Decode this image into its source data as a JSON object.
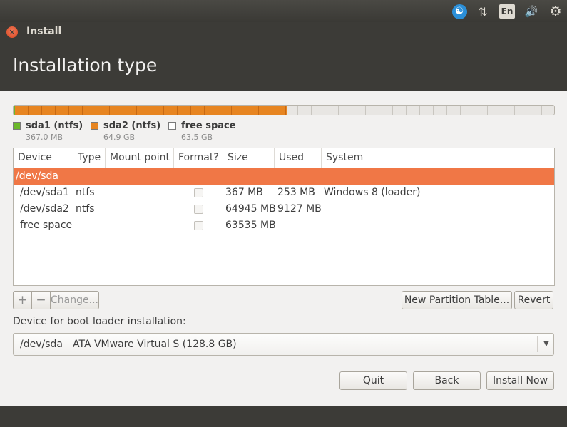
{
  "panel": {
    "keyboard_label": "En",
    "accessibility_icon": "accessibility-icon",
    "network_icon": "network-arrows-icon",
    "sound_icon": "speaker-icon",
    "settings_icon": "gear-icon"
  },
  "window": {
    "title": "Install"
  },
  "page": {
    "title": "Installation type"
  },
  "partition_bar": {
    "segments": [
      {
        "name": "sda1 (ntfs)",
        "size": "367.0 MB",
        "color": "#6bb82a",
        "fraction": 0.0028
      },
      {
        "name": "sda2 (ntfs)",
        "size": "64.9 GB",
        "color": "#e78521",
        "fraction": 0.5042
      },
      {
        "name": "free space",
        "size": "63.5 GB",
        "color": "#e8e6e3",
        "fraction": 0.493
      }
    ]
  },
  "legend": {
    "sda1": {
      "label": "sda1 (ntfs)",
      "size": "367.0 MB",
      "color": "#6bb82a"
    },
    "sda2": {
      "label": "sda2 (ntfs)",
      "size": "64.9 GB",
      "color": "#e78521"
    },
    "free": {
      "label": "free space",
      "size": "63.5 GB",
      "color": "#ffffff"
    }
  },
  "table": {
    "headers": {
      "device": "Device",
      "type": "Type",
      "mount": "Mount point",
      "format": "Format?",
      "size": "Size",
      "used": "Used",
      "system": "System"
    },
    "disk_row": {
      "device": "/dev/sda"
    },
    "rows": [
      {
        "device": "/dev/sda1",
        "type": "ntfs",
        "mount": "",
        "format": false,
        "size": "367 MB",
        "used": "253 MB",
        "system": "Windows 8 (loader)"
      },
      {
        "device": "/dev/sda2",
        "type": "ntfs",
        "mount": "",
        "format": false,
        "size": "64945 MB",
        "used": "9127 MB",
        "system": ""
      },
      {
        "device": "free space",
        "type": "",
        "mount": "",
        "format": false,
        "size": "63535 MB",
        "used": "",
        "system": ""
      }
    ]
  },
  "toolbar": {
    "add_label": "+",
    "remove_label": "−",
    "change_label": "Change...",
    "new_table_label": "New Partition Table...",
    "revert_label": "Revert"
  },
  "bootloader": {
    "label": "Device for boot loader installation:",
    "device": "/dev/sda",
    "description": "ATA VMware Virtual S (128.8 GB)"
  },
  "buttons": {
    "quit": "Quit",
    "back": "Back",
    "install": "Install Now"
  },
  "colors": {
    "selection": "#f07746",
    "panel": "#3c3b37"
  }
}
